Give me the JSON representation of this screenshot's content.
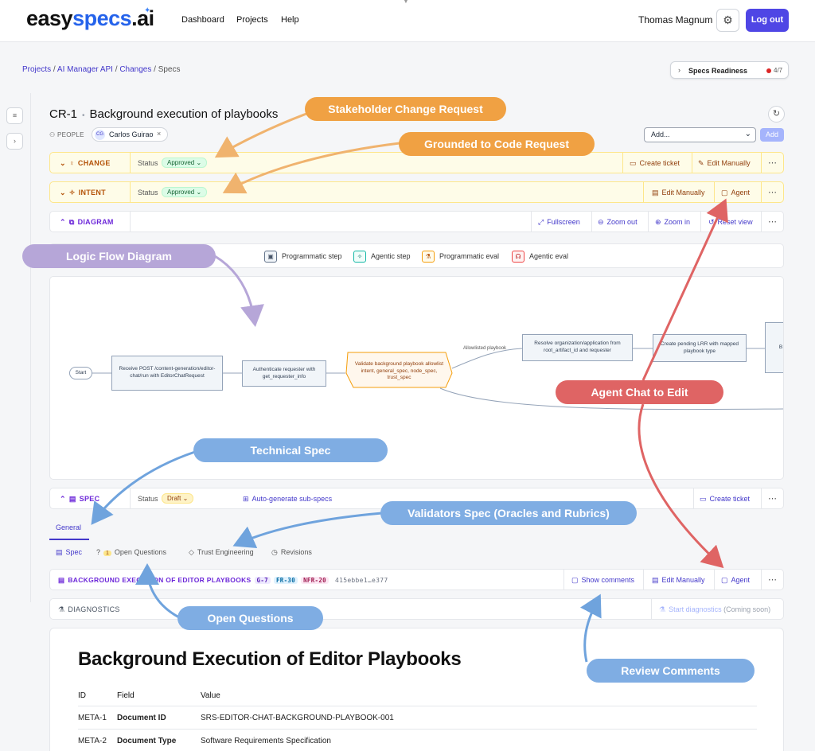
{
  "header": {
    "logo_part1": "easy",
    "logo_part2": "specs",
    "logo_part3": ".ai",
    "nav": [
      "Dashboard",
      "Projects",
      "Help"
    ],
    "user_name": "Thomas Magnum",
    "logout_label": "Log out"
  },
  "breadcrumb": {
    "items": [
      "Projects",
      "AI Manager API",
      "Changes"
    ],
    "current": "Specs"
  },
  "readiness": {
    "label": "Specs Readiness",
    "count": "4/7",
    "status_color": "#dc2626"
  },
  "cr": {
    "id": "CR-1",
    "title": "Background execution of playbooks"
  },
  "people": {
    "label": "PEOPLE",
    "chip_initials": "CG",
    "chip_name": "Carlos Guirao"
  },
  "add": {
    "select_value": "Add...",
    "button": "Add"
  },
  "change_row": {
    "label": "CHANGE",
    "status_label": "Status",
    "status": "Approved",
    "actions": [
      "Create ticket",
      "Edit Manually"
    ]
  },
  "intent_row": {
    "label": "INTENT",
    "status_label": "Status",
    "status": "Approved",
    "actions": [
      "Edit Manually",
      "Agent"
    ]
  },
  "diagram_row": {
    "label": "DIAGRAM",
    "actions": [
      "Fullscreen",
      "Zoom out",
      "Zoom in",
      "Reset view"
    ]
  },
  "legend": [
    "Programmatic step",
    "Agentic step",
    "Programmatic eval",
    "Agentic eval"
  ],
  "diagram": {
    "start": "Start",
    "node1": "Receive POST /content-generation/editor-chat/run with EditorChatRequest",
    "node2": "Authenticate requester with get_requester_info",
    "node3": "Validate background playbook allowlist intent, general_spec, node_spec, trust_spec",
    "edge_label": "Allowlisted playbook",
    "node4": "Resolve organization/application from root_artifact_id and requester",
    "node5": "Create pending LRR with mapped playbook type",
    "node6": "B"
  },
  "spec_row": {
    "label": "SPEC",
    "status_label": "Status",
    "status": "Draft",
    "auto": "Auto-generate sub-specs",
    "actions": [
      "Create ticket"
    ]
  },
  "tabs": {
    "general": "General"
  },
  "subtabs": {
    "spec": "Spec",
    "oq_count": "1",
    "oq": "Open Questions",
    "trust": "Trust Engineering",
    "revisions": "Revisions"
  },
  "spec_header": {
    "title": "BACKGROUND EXECUTION OF EDITOR PLAYBOOKS",
    "tags": [
      "G-7",
      "FR-30",
      "NFR-20"
    ],
    "hash": "415ebbe1…e377",
    "actions": [
      "Show comments",
      "Edit Manually",
      "Agent"
    ]
  },
  "diagnostics": {
    "label": "DIAGNOSTICS",
    "action": "Start diagnostics",
    "note": "(Coming soon)"
  },
  "document": {
    "title": "Background Execution of Editor Playbooks",
    "columns": [
      "ID",
      "Field",
      "Value"
    ],
    "rows": [
      [
        "META-1",
        "Document ID",
        "SRS-EDITOR-CHAT-BACKGROUND-PLAYBOOK-001"
      ],
      [
        "META-2",
        "Document Type",
        "Software Requirements Specification"
      ]
    ]
  },
  "callouts": {
    "stakeholder": "Stakeholder Change Request",
    "grounded": "Grounded to Code Request",
    "logic": "Logic Flow Diagram",
    "agent_chat": "Agent Chat to Edit",
    "technical": "Technical Spec",
    "validators": "Validators Spec (Oracles and Rubrics)",
    "open_q": "Open Questions",
    "review": "Review Comments"
  },
  "colors": {
    "accent": "#4338ca",
    "button": "#4f46e5",
    "orange_callout": "#f0a143",
    "blue_callout": "#7fade3",
    "red_callout": "#df6464",
    "purple_callout": "#b6a6d8"
  }
}
